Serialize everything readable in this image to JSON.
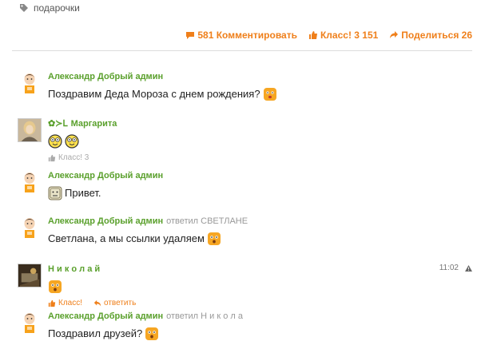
{
  "tag": {
    "label": "подарочки"
  },
  "stats": {
    "comments": "581 Комментировать",
    "likes": "Класс! 3 151",
    "share": "Поделиться 26"
  },
  "comments": [
    {
      "author": "Александр Добрый админ",
      "text": "Поздравим Деда Мороза с днем рождения?"
    },
    {
      "author": "Маргарита",
      "author_prefix": "✿≻ᒪ",
      "text": "",
      "likes": "Класс! 3"
    },
    {
      "author": "Александр Добрый админ",
      "text": "Привет."
    },
    {
      "author": "Александр Добрый админ",
      "reply_to": "ответил СВЕТЛАНЕ",
      "text": "Светлана, а мы ссылки удаляем"
    },
    {
      "author": "Н и к о л а й",
      "time": "11:02",
      "text": "",
      "like_action": "Класс!",
      "reply_action": "ответить"
    },
    {
      "author": "Александр Добрый админ",
      "reply_to": "ответил Н и к о л а",
      "text": "Поздравил друзей?"
    }
  ],
  "icons": {
    "tag": "tag-icon",
    "comment": "speech-bubble-icon",
    "like": "thumbs-up-icon",
    "share": "share-arrow-icon",
    "reply": "reply-arrow-icon",
    "warning": "warning-icon"
  },
  "colors": {
    "accent": "#ef7f1a",
    "author": "#5aa02c",
    "muted": "#999999"
  }
}
